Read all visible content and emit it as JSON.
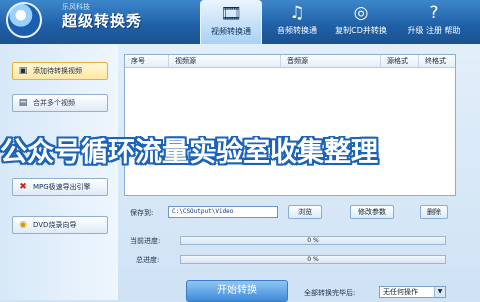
{
  "header": {
    "logo_small": "乐风科技",
    "logo_title": "超级转换秀",
    "tabs": [
      {
        "label": "视频转换通",
        "icon": "film-icon"
      },
      {
        "label": "音频转换通",
        "icon": "music-note-icon"
      },
      {
        "label": "复制CD并转换",
        "icon": "cd-icon"
      },
      {
        "label": "升级 注册 帮助",
        "icon": "help-icon"
      }
    ]
  },
  "sidebar": {
    "items": [
      {
        "label": "添加待转换视频",
        "icon": "add-video-icon"
      },
      {
        "label": "合并多个视频",
        "icon": "merge-icon"
      },
      {
        "label": "MPG极速导出引擎",
        "icon": "mpg-export-icon"
      },
      {
        "label": "DVD烧录向导",
        "icon": "dvd-icon"
      }
    ]
  },
  "list": {
    "columns": [
      "序号",
      "视频源",
      "音频源",
      "源格式",
      "终格式"
    ]
  },
  "save": {
    "label": "保存到:",
    "path": "C:\\CSOutput\\Video",
    "browse": "浏览",
    "modify": "修改参数",
    "delete": "删除"
  },
  "progress": {
    "current_label": "当前进度:",
    "current_text": "0 %",
    "current_value": 0,
    "total_label": "总进度:",
    "total_text": "0 %",
    "total_value": 0
  },
  "footer": {
    "start": "开始转换",
    "after_label": "全部转换完毕后:",
    "after_value": "无任何操作"
  },
  "watermark": "公众号循环流量实验室收集整理"
}
